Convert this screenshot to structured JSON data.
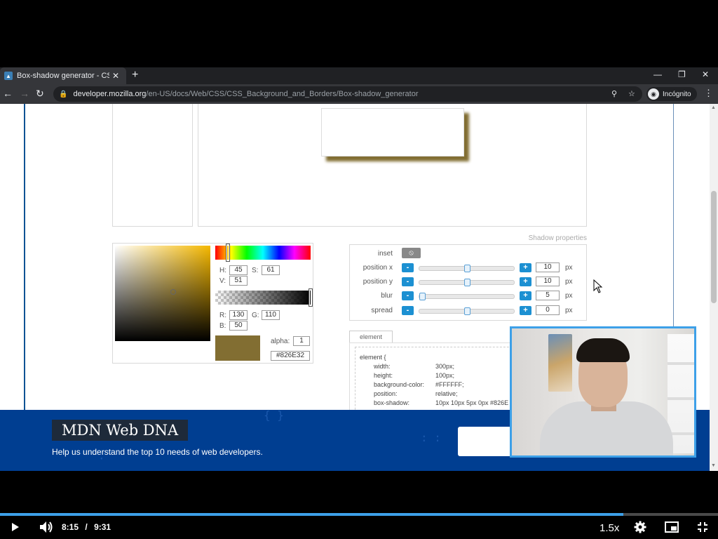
{
  "browser": {
    "tab_title": "Box-shadow generator - CSS: Ca",
    "tab_close": "✕",
    "new_tab": "+",
    "url_host": "developer.mozilla.org",
    "url_path": "/en-US/docs/Web/CSS/CSS_Background_and_Borders/Box-shadow_generator",
    "profile_label": "Incógnito"
  },
  "picker": {
    "h_label": "H:",
    "h": "45",
    "s_label": "S:",
    "s": "61",
    "v_label": "V:",
    "v": "51",
    "r_label": "R:",
    "r": "130",
    "g_label": "G:",
    "g": "110",
    "b_label": "B:",
    "b": "50",
    "alpha_label": "alpha:",
    "alpha": "1",
    "hex": "#826E32",
    "color": "#826E32"
  },
  "shadow": {
    "title": "Shadow properties",
    "inset_label": "inset",
    "rows": [
      {
        "label": "position x",
        "value": "10",
        "unit": "px",
        "level": 0.5
      },
      {
        "label": "position y",
        "value": "10",
        "unit": "px",
        "level": 0.5
      },
      {
        "label": "blur",
        "value": "5",
        "unit": "px",
        "level": 0.0
      },
      {
        "label": "spread",
        "value": "0",
        "unit": "px",
        "level": 0.5
      }
    ],
    "minus": "-",
    "plus": "+"
  },
  "element_panel": {
    "tab": "element",
    "code": [
      {
        "prop": "element {",
        "val": ""
      },
      {
        "prop": "width:",
        "val": "300px;"
      },
      {
        "prop": "height:",
        "val": "100px;"
      },
      {
        "prop": "background-color:",
        "val": "#FFFFFF;"
      },
      {
        "prop": "position:",
        "val": "relative;"
      },
      {
        "prop": "box-shadow:",
        "val": "10px 10px 5px 0px #826E"
      }
    ]
  },
  "banner": {
    "title": "MDN Web DNA",
    "subtitle": "Help us understand the top 10 needs of web developers."
  },
  "player": {
    "current_time": "8:15",
    "separator": "/",
    "duration": "9:31",
    "speed": "1.5x",
    "progress": 0.868
  }
}
